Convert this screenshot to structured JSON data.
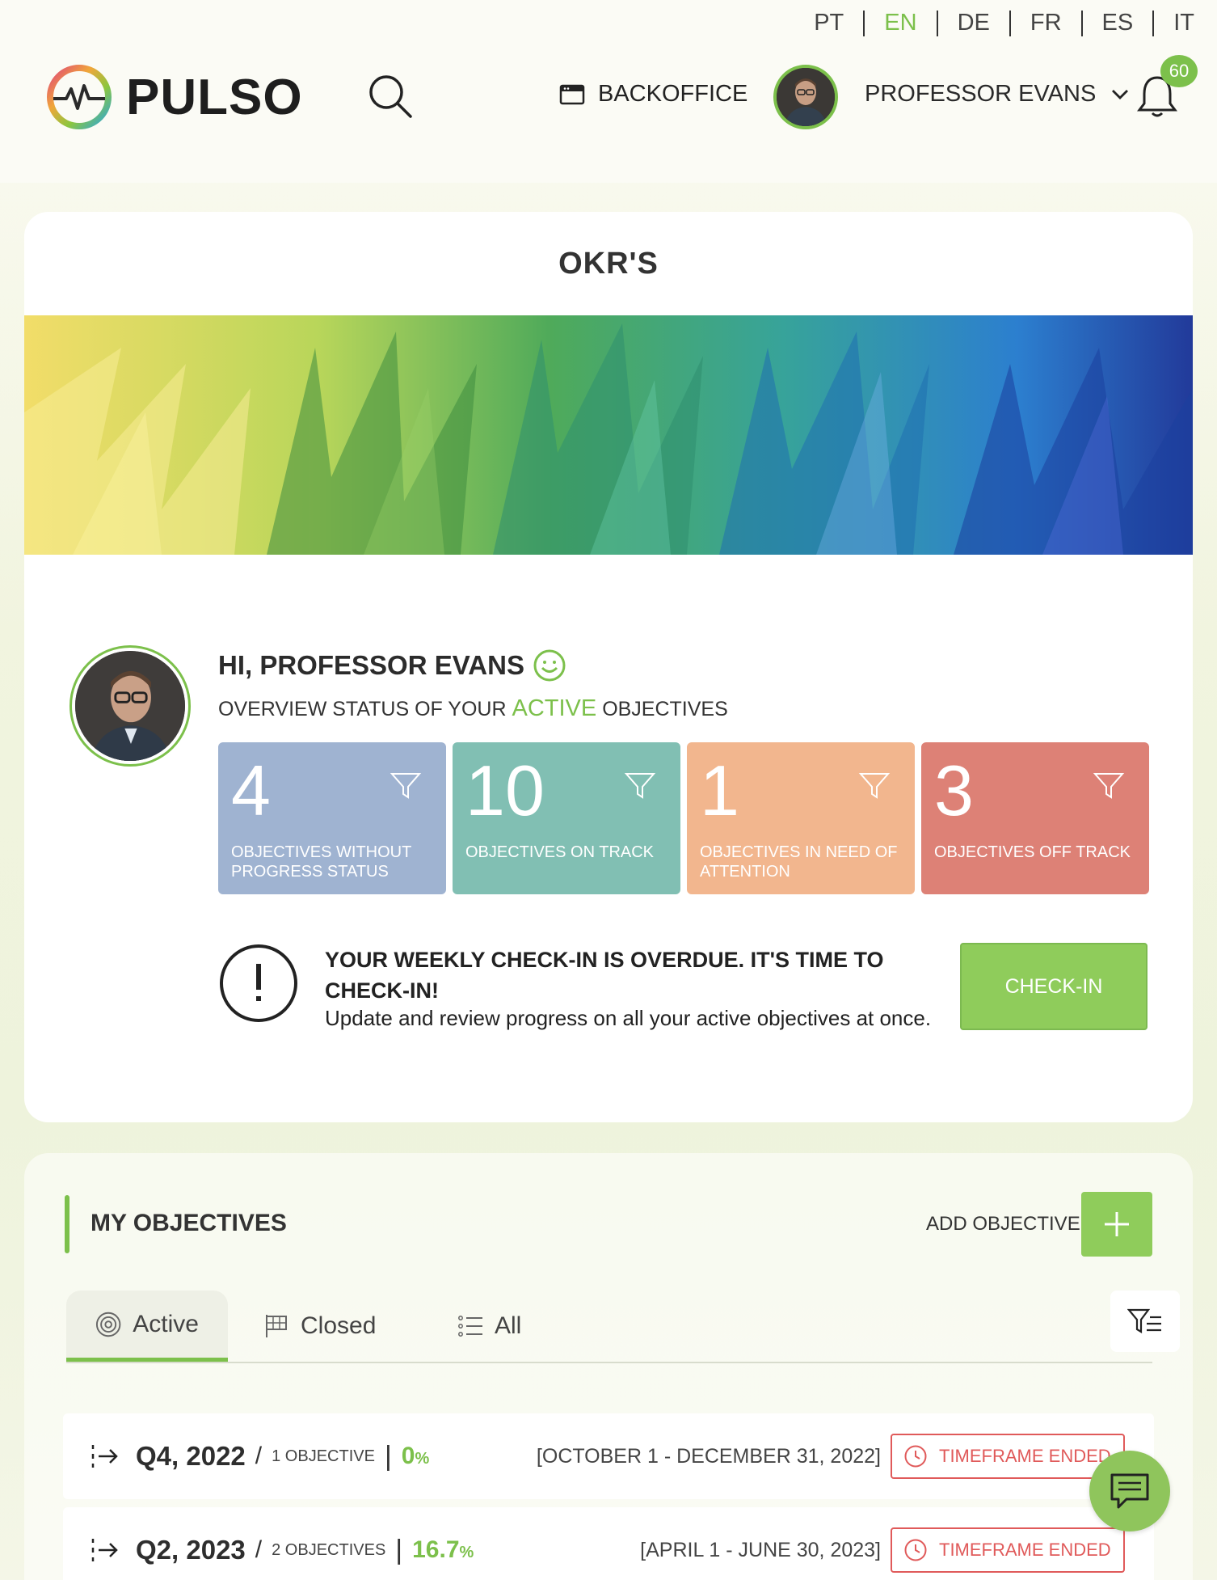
{
  "languages": [
    {
      "code": "PT",
      "active": false
    },
    {
      "code": "EN",
      "active": true
    },
    {
      "code": "DE",
      "active": false
    },
    {
      "code": "FR",
      "active": false
    },
    {
      "code": "ES",
      "active": false
    },
    {
      "code": "IT",
      "active": false
    }
  ],
  "header": {
    "brand": "PULSO",
    "backoffice_label": "BACKOFFICE",
    "user_name": "PROFESSOR EVANS",
    "notification_count": "60"
  },
  "okr_card": {
    "title": "OKR'S",
    "greeting": "HI, PROFESSOR EVANS",
    "overview_prefix": "OVERVIEW STATUS OF YOUR",
    "overview_highlight": "ACTIVE",
    "overview_suffix": "OBJECTIVES",
    "stats": [
      {
        "value": "4",
        "label": "OBJECTIVES WITHOUT PROGRESS STATUS",
        "color": "#9fb3d1"
      },
      {
        "value": "10",
        "label": "OBJECTIVES ON TRACK",
        "color": "#81bfb3"
      },
      {
        "value": "1",
        "label": "OBJECTIVES IN NEED OF ATTENTION",
        "color": "#f2b68e"
      },
      {
        "value": "3",
        "label": "OBJECTIVES OFF TRACK",
        "color": "#dd8176"
      }
    ],
    "alert_title": "YOUR WEEKLY CHECK-IN IS OVERDUE. IT'S TIME TO CHECK-IN!",
    "alert_subtitle": "Update and review progress on all your active objectives at once.",
    "checkin_label": "CHECK-IN"
  },
  "objectives": {
    "title": "MY OBJECTIVES",
    "add_label": "ADD OBJECTIVE",
    "tabs": [
      {
        "label": "Active",
        "icon": "target-icon",
        "active": true
      },
      {
        "label": "Closed",
        "icon": "flag-icon",
        "active": false
      },
      {
        "label": "All",
        "icon": "list-icon",
        "active": false
      }
    ],
    "rows": [
      {
        "quarter": "Q4, 2022",
        "count": "1 OBJECTIVE",
        "percent": "0",
        "percent_unit": "%",
        "dates": "[OCTOBER 1 - DECEMBER 31, 2022]",
        "status": "TIMEFRAME ENDED"
      },
      {
        "quarter": "Q2, 2023",
        "count": "2 OBJECTIVES",
        "percent": "16.7",
        "percent_unit": "%",
        "dates": "[APRIL 1 - JUNE 30, 2023]",
        "status": "TIMEFRAME ENDED"
      }
    ]
  },
  "colors": {
    "accent": "#7cc04b",
    "danger": "#e05a5a"
  }
}
